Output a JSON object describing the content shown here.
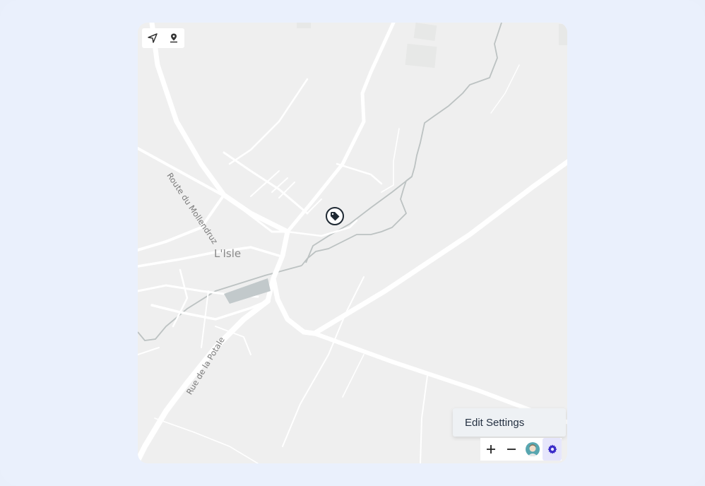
{
  "map": {
    "place_label": "L'Isle",
    "road_labels": [
      "Route du Mollendruz",
      "Rue de la Potale"
    ]
  },
  "map_controls": {
    "top_left": [
      {
        "icon": "navigation-arrow-icon"
      },
      {
        "icon": "map-pin-icon"
      }
    ],
    "poi": {
      "icon": "tag-icon"
    }
  },
  "settings_menu": {
    "items": [
      "Edit Settings"
    ]
  },
  "toolbar": {
    "buttons": [
      {
        "icon": "plus-icon"
      },
      {
        "icon": "minus-icon"
      },
      {
        "icon": "avatar-icon"
      },
      {
        "icon": "gear-icon"
      }
    ]
  },
  "colors": {
    "background": "#eaf0fc",
    "map_base": "#efefef",
    "road": "#ffffff",
    "river": "#b9bfbf",
    "accent": "#3a2bc8"
  }
}
